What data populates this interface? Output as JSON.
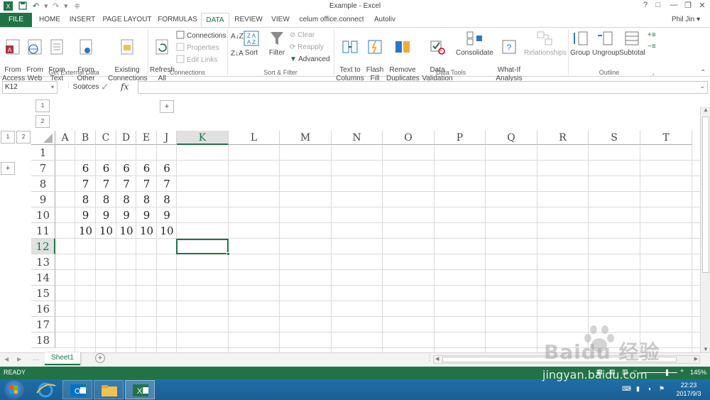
{
  "window": {
    "title": "Example - Excel"
  },
  "quick_access": {
    "save_icon": "save-icon",
    "undo_icon": "undo-icon",
    "redo_icon": "redo-icon"
  },
  "window_controls": [
    "?",
    "□",
    "—",
    "❐",
    "✕"
  ],
  "tabs": [
    "FILE",
    "HOME",
    "INSERT",
    "PAGE LAYOUT",
    "FORMULAS",
    "DATA",
    "REVIEW",
    "VIEW",
    "celum office.connect",
    "Autoliv"
  ],
  "active_tab": "DATA",
  "user": "Phil Jin",
  "ribbon": {
    "get_external": {
      "from_access": "From\nAccess",
      "from_web": "From\nWeb",
      "from_text": "From\nText",
      "from_other": "From Other\nSources",
      "existing": "Existing\nConnections",
      "group": "Get External Data"
    },
    "connections": {
      "refresh": "Refresh\nAll",
      "connections": "Connections",
      "properties": "Properties",
      "edit_links": "Edit Links",
      "group": "Connections"
    },
    "sort_filter": {
      "sort": "Sort",
      "filter": "Filter",
      "clear": "Clear",
      "reapply": "Reapply",
      "advanced": "Advanced",
      "group": "Sort & Filter"
    },
    "data_tools": {
      "text_to_columns": "Text to\nColumns",
      "flash_fill": "Flash\nFill",
      "remove_duplicates": "Remove\nDuplicates",
      "data_validation": "Data\nValidation",
      "consolidate": "Consolidate",
      "what_if": "What-If\nAnalysis",
      "relationships": "Relationships",
      "group": "Data Tools"
    },
    "outline": {
      "group_btn": "Group",
      "ungroup": "Ungroup",
      "subtotal": "Subtotal",
      "group": "Outline"
    }
  },
  "formula_bar": {
    "name_box": "K12",
    "fx_label": "fx",
    "value": ""
  },
  "outline_controls": {
    "col_levels": [
      "1",
      "2"
    ],
    "row_levels": [
      "1",
      "2"
    ],
    "expand_col": "+",
    "expand_row": "+"
  },
  "columns": [
    "A",
    "B",
    "C",
    "D",
    "E",
    "J",
    "K",
    "L",
    "M",
    "N",
    "O",
    "P",
    "Q",
    "R",
    "S",
    "T"
  ],
  "selected_column": "K",
  "rows": [
    "1",
    "7",
    "8",
    "9",
    "10",
    "11",
    "12",
    "13",
    "14",
    "15",
    "16",
    "17",
    "18"
  ],
  "selected_row": "12",
  "cells": [
    {
      "row": "7",
      "values": [
        "6",
        "6",
        "6",
        "6",
        "6"
      ]
    },
    {
      "row": "8",
      "values": [
        "7",
        "7",
        "7",
        "7",
        "7"
      ]
    },
    {
      "row": "9",
      "values": [
        "8",
        "8",
        "8",
        "8",
        "8"
      ]
    },
    {
      "row": "10",
      "values": [
        "9",
        "9",
        "9",
        "9",
        "9"
      ]
    },
    {
      "row": "11",
      "values": [
        "10",
        "10",
        "10",
        "10",
        "10"
      ]
    }
  ],
  "sheet_tabs": [
    "Sheet1"
  ],
  "status": {
    "ready": "READY",
    "zoom": "145%"
  },
  "taskbar": {
    "time": "22:23",
    "date": "2017/9/3"
  },
  "watermark": {
    "logo": "Baidu 经验",
    "url": "jingyan.baidu.com"
  },
  "colors": {
    "accent": "#217346",
    "taskbar": "#1e6ea8"
  }
}
